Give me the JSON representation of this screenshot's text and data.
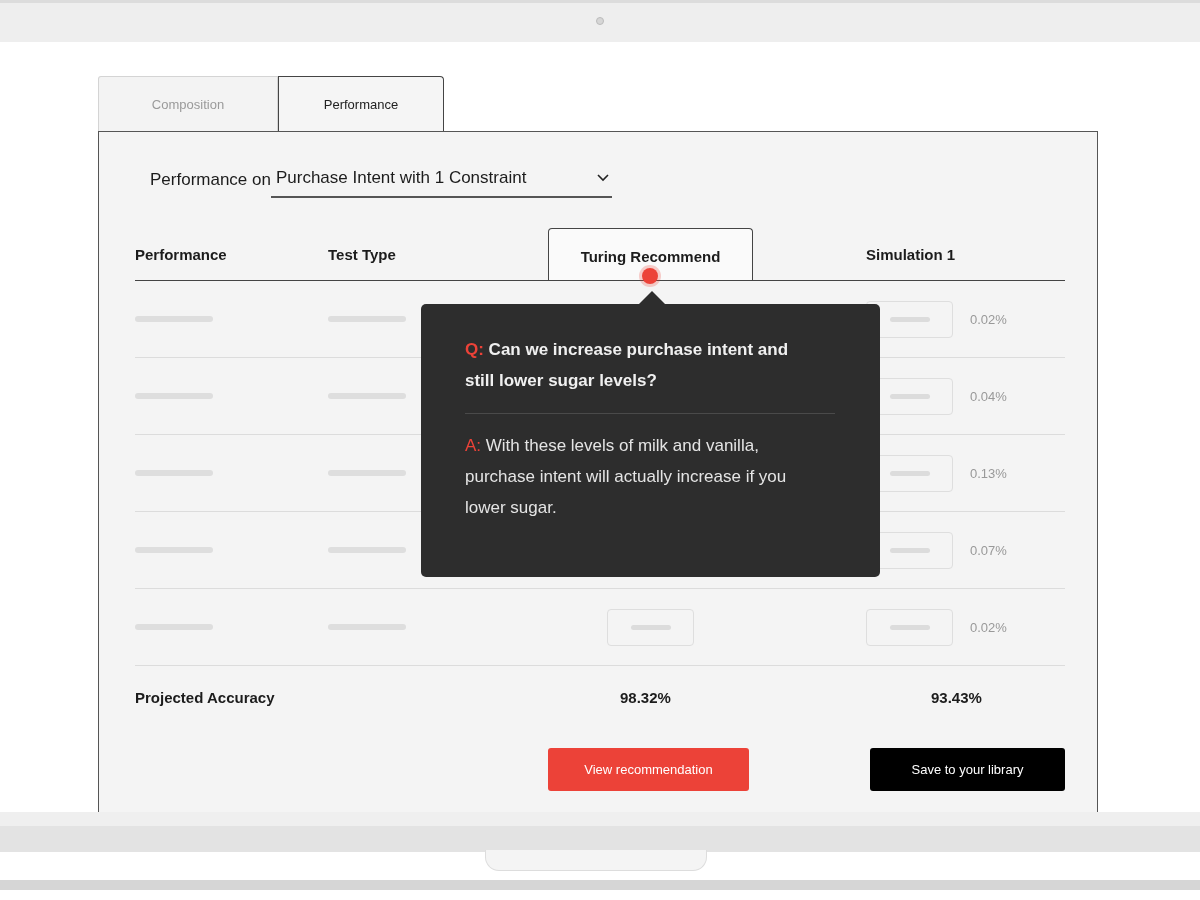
{
  "tabs": [
    {
      "label": "Composition",
      "selected": false
    },
    {
      "label": "Performance",
      "selected": true
    }
  ],
  "filter": {
    "label": "Performance on",
    "value": "Purchase Intent with 1 Constraint"
  },
  "table": {
    "columns": [
      {
        "label": "Performance",
        "highlighted": false
      },
      {
        "label": "Test Type",
        "highlighted": false
      },
      {
        "label": "Turing Recommend",
        "highlighted": true
      },
      {
        "label": "Simulation 1",
        "highlighted": false
      }
    ],
    "rows": [
      {
        "simulation_1": "0.02%"
      },
      {
        "simulation_1": "0.04%"
      },
      {
        "simulation_1": "0.13%"
      },
      {
        "simulation_1": "0.07%"
      },
      {
        "simulation_1": "0.02%"
      }
    ],
    "footer": {
      "label": "Projected Accuracy",
      "turing_recommend": "98.32%",
      "simulation_1": "93.43%"
    }
  },
  "tooltip": {
    "question_prefix": "Q:",
    "question": "Can we increase purchase intent and still lower sugar levels?",
    "answer_prefix": "A:",
    "answer": "With these levels of milk and vanilla, purchase intent will actually increase if you lower sugar."
  },
  "buttons": [
    {
      "label": "View recommendation",
      "kind": "primary"
    },
    {
      "label": "Save to your library",
      "kind": "dark"
    }
  ]
}
